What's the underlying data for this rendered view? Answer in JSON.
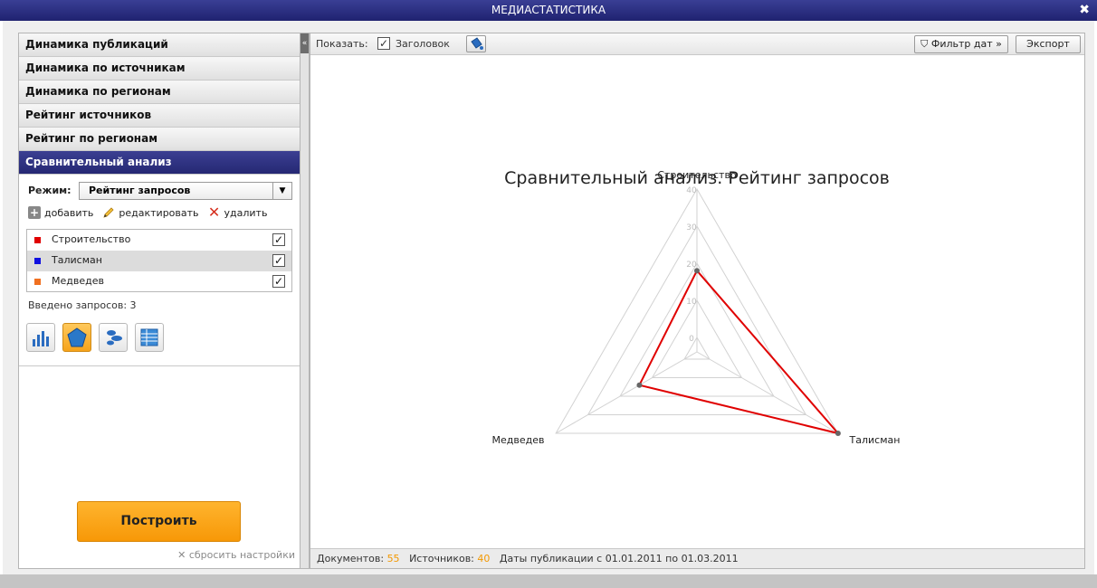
{
  "window": {
    "title": "МЕДИАСТАТИСТИКА",
    "close_icon": "close-icon"
  },
  "sidebar": {
    "items": [
      {
        "label": "Динамика публикаций",
        "active": false
      },
      {
        "label": "Динамика по источникам",
        "active": false
      },
      {
        "label": "Динамика по регионам",
        "active": false
      },
      {
        "label": "Рейтинг источников",
        "active": false
      },
      {
        "label": "Рейтинг по регионам",
        "active": false
      },
      {
        "label": "Сравнительный анализ",
        "active": true
      }
    ],
    "mode_label": "Режим:",
    "mode_value": "Рейтинг запросов",
    "actions": {
      "add": "добавить",
      "edit": "редактировать",
      "delete": "удалить"
    },
    "queries": [
      {
        "label": "Строительство",
        "color": "#e00000",
        "checked": true,
        "selected": false
      },
      {
        "label": "Талисман",
        "color": "#1010e0",
        "checked": true,
        "selected": true
      },
      {
        "label": "Медведев",
        "color": "#f07020",
        "checked": true,
        "selected": false
      }
    ],
    "counter": "Введено запросов: 3",
    "view_buttons": [
      "bar-chart-icon",
      "radar-chart-icon",
      "bubble-chart-icon",
      "table-icon"
    ],
    "active_view": 1,
    "build_label": "Построить",
    "reset_label": "сбросить настройки"
  },
  "toolbar": {
    "show_label": "Показать:",
    "header_checkbox_label": "Заголовок",
    "header_checked": true,
    "filter_label": "Фильтр дат",
    "export_label": "Экспорт"
  },
  "chart_data": {
    "type": "radar",
    "title": "Сравнительный анализ. Рейтинг запросов",
    "axes": [
      "Строительство",
      "Талисман",
      "Медведев"
    ],
    "rlim": [
      0,
      40
    ],
    "ticks": [
      0,
      10,
      20,
      30,
      40
    ],
    "series": [
      {
        "color": "#e00000",
        "values": [
          18,
          40,
          14
        ]
      }
    ]
  },
  "status": {
    "docs_label": "Документов:",
    "docs_value": "55",
    "sources_label": "Источников:",
    "sources_value": "40",
    "dates_text": "Даты публикации с 01.01.2011 по 01.03.2011"
  }
}
